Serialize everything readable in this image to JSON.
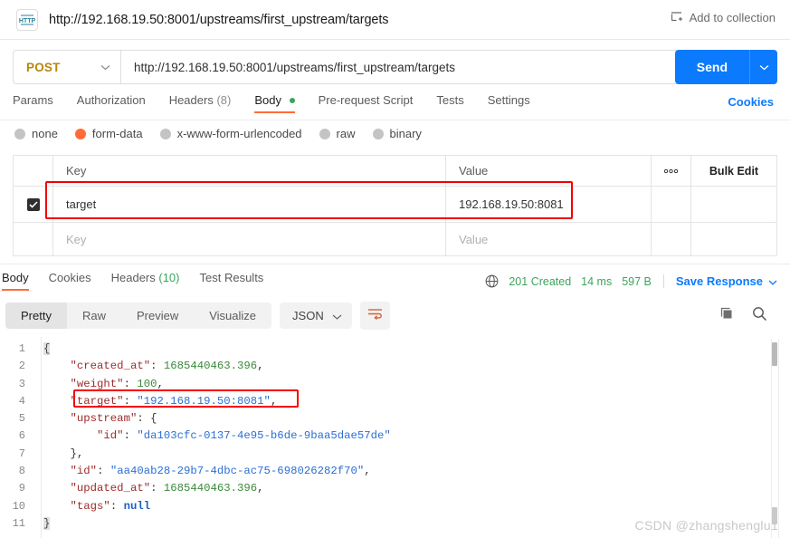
{
  "topbar": {
    "protocol_badge": "HTTP",
    "request_title": "http://192.168.19.50:8001/upstreams/first_upstream/targets",
    "add_to_collection_label": "Add to collection"
  },
  "url_row": {
    "method": "POST",
    "url": "http://192.168.19.50:8001/upstreams/first_upstream/targets",
    "send_label": "Send"
  },
  "request_tabs": {
    "items": [
      {
        "label": "Params",
        "active": false
      },
      {
        "label": "Authorization",
        "active": false
      },
      {
        "label": "Headers",
        "count": "(8)",
        "active": false
      },
      {
        "label": "Body",
        "active": true,
        "dot": true
      },
      {
        "label": "Pre-request Script",
        "active": false
      },
      {
        "label": "Tests",
        "active": false
      },
      {
        "label": "Settings",
        "active": false
      }
    ],
    "cookies_label": "Cookies"
  },
  "body_types": [
    {
      "label": "none",
      "selected": false
    },
    {
      "label": "form-data",
      "selected": true
    },
    {
      "label": "x-www-form-urlencoded",
      "selected": false
    },
    {
      "label": "raw",
      "selected": false
    },
    {
      "label": "binary",
      "selected": false
    }
  ],
  "kv_table": {
    "header": {
      "key": "Key",
      "value": "Value",
      "options": "○○○",
      "bulk_edit": "Bulk Edit"
    },
    "rows": [
      {
        "checked": true,
        "key": "target",
        "value": "192.168.19.50:8081"
      }
    ],
    "empty_row": {
      "key_placeholder": "Key",
      "value_placeholder": "Value"
    }
  },
  "response_tabs": {
    "items": [
      {
        "label": "Body",
        "active": true
      },
      {
        "label": "Cookies",
        "active": false
      },
      {
        "label": "Headers",
        "count": "(10)",
        "active": false
      },
      {
        "label": "Test Results",
        "active": false
      }
    ]
  },
  "response_meta": {
    "status": "201 Created",
    "time": "14 ms",
    "size": "597 B",
    "save_response_label": "Save Response"
  },
  "format_bar": {
    "tabs": [
      {
        "label": "Pretty",
        "active": true
      },
      {
        "label": "Raw",
        "active": false
      },
      {
        "label": "Preview",
        "active": false
      },
      {
        "label": "Visualize",
        "active": false
      }
    ],
    "language": "JSON"
  },
  "code": {
    "lines": [
      {
        "no": "1",
        "tokens": [
          {
            "t": "{",
            "c": "brace"
          }
        ]
      },
      {
        "no": "2",
        "tokens": [
          {
            "t": "    ",
            "c": "p"
          },
          {
            "t": "\"created_at\"",
            "c": "k"
          },
          {
            "t": ": ",
            "c": "p"
          },
          {
            "t": "1685440463.396",
            "c": "n"
          },
          {
            "t": ",",
            "c": "p"
          }
        ]
      },
      {
        "no": "3",
        "tokens": [
          {
            "t": "    ",
            "c": "p"
          },
          {
            "t": "\"weight\"",
            "c": "k"
          },
          {
            "t": ": ",
            "c": "p"
          },
          {
            "t": "100",
            "c": "n"
          },
          {
            "t": ",",
            "c": "p"
          }
        ]
      },
      {
        "no": "4",
        "tokens": [
          {
            "t": "    ",
            "c": "p"
          },
          {
            "t": "\"target\"",
            "c": "k"
          },
          {
            "t": ": ",
            "c": "p"
          },
          {
            "t": "\"192.168.19.50:8081\"",
            "c": "s"
          },
          {
            "t": ",",
            "c": "p"
          }
        ]
      },
      {
        "no": "5",
        "tokens": [
          {
            "t": "    ",
            "c": "p"
          },
          {
            "t": "\"upstream\"",
            "c": "k"
          },
          {
            "t": ": ",
            "c": "p"
          },
          {
            "t": "{",
            "c": "p"
          }
        ]
      },
      {
        "no": "6",
        "tokens": [
          {
            "t": "        ",
            "c": "p"
          },
          {
            "t": "\"id\"",
            "c": "k"
          },
          {
            "t": ": ",
            "c": "p"
          },
          {
            "t": "\"da103cfc-0137-4e95-b6de-9baa5dae57de\"",
            "c": "s"
          }
        ]
      },
      {
        "no": "7",
        "tokens": [
          {
            "t": "    ",
            "c": "p"
          },
          {
            "t": "},",
            "c": "p"
          }
        ]
      },
      {
        "no": "8",
        "tokens": [
          {
            "t": "    ",
            "c": "p"
          },
          {
            "t": "\"id\"",
            "c": "k"
          },
          {
            "t": ": ",
            "c": "p"
          },
          {
            "t": "\"aa40ab28-29b7-4dbc-ac75-698026282f70\"",
            "c": "s"
          },
          {
            "t": ",",
            "c": "p"
          }
        ]
      },
      {
        "no": "9",
        "tokens": [
          {
            "t": "    ",
            "c": "p"
          },
          {
            "t": "\"updated_at\"",
            "c": "k"
          },
          {
            "t": ": ",
            "c": "p"
          },
          {
            "t": "1685440463.396",
            "c": "n"
          },
          {
            "t": ",",
            "c": "p"
          }
        ]
      },
      {
        "no": "10",
        "tokens": [
          {
            "t": "    ",
            "c": "p"
          },
          {
            "t": "\"tags\"",
            "c": "k"
          },
          {
            "t": ": ",
            "c": "p"
          },
          {
            "t": "null",
            "c": "b"
          }
        ]
      },
      {
        "no": "11",
        "tokens": [
          {
            "t": "}",
            "c": "brace"
          }
        ]
      }
    ]
  },
  "watermark": "CSDN @zhangshenglu1",
  "colors": {
    "accent_orange": "#ff6c37",
    "send_blue": "#0c7afd",
    "status_green": "#3ba55d",
    "method_post": "#b8860b",
    "highlight_red": "#f50000"
  }
}
